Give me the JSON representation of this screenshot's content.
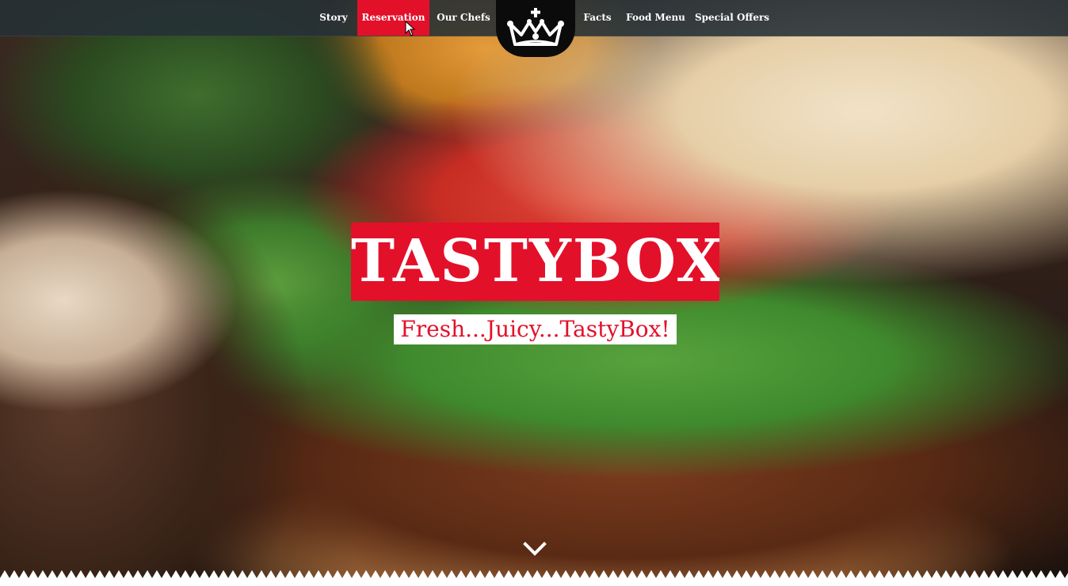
{
  "nav": {
    "items": [
      {
        "label": "Story"
      },
      {
        "label": "Reservation",
        "active": true
      },
      {
        "label": "Our Chefs"
      },
      {
        "label": "Facts"
      },
      {
        "label": "Food Menu"
      },
      {
        "label": "Special Offers"
      }
    ]
  },
  "logo": {
    "icon": "crown-icon"
  },
  "hero": {
    "title": "TASTYBOX",
    "tagline": "Fresh...Juicy...TastyBox!",
    "scroll_icon": "chevron-down-icon"
  },
  "colors": {
    "accent": "#e3102a",
    "navbar": "#263036",
    "logo_bg": "#0b0b0b",
    "text_light": "#ffffff"
  }
}
